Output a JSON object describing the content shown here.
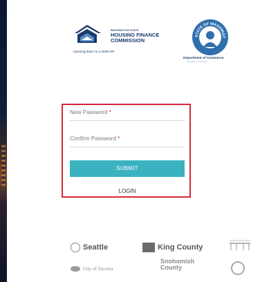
{
  "header": {
    "hfc_small": "WASHINGTON STATE",
    "hfc_line1": "HOUSING FINANCE",
    "hfc_line2": "COMMISSION",
    "hfc_tagline": "Opening doors to a better life",
    "seal_text": "STATE OF WASHINGTON",
    "commerce_name": "Department of Commerce",
    "commerce_sub": "Innovation is in our nature."
  },
  "form": {
    "new_password_label": "New Password",
    "confirm_password_label": "Confirm Password",
    "required_mark": "*",
    "submit_label": "SUBMIT",
    "login_label": "LOGIN"
  },
  "partners": {
    "seattle": "Seattle",
    "king_county": "King County",
    "tacoma": "City of Tacoma",
    "snohomish_line1": "Snohomish",
    "snohomish_line2": "County"
  },
  "colors": {
    "accent": "#3bb2c0",
    "highlight_border": "#d3263a",
    "brand_navy": "#1b3a6b",
    "seal_blue": "#2f6fae"
  }
}
